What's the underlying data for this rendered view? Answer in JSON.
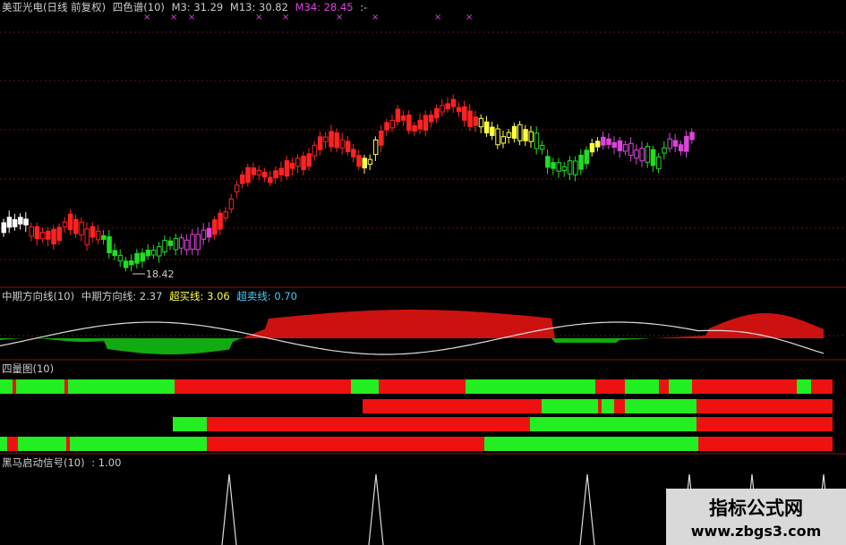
{
  "panel1": {
    "stock_name": "美亚光电(日线 前复权)",
    "indicator": "四色谱(10)",
    "m3": "M3: 31.29",
    "m13": "M13: 30.82",
    "m34": "M34: 28.45",
    "tail": ":-",
    "low_label": "18.42"
  },
  "panel2": {
    "name": "中期方向线(10)",
    "direction": "中期方向线: 2.37",
    "overbought": "超买线: 3.06",
    "oversold": "超卖线: 0.70"
  },
  "panel3": {
    "name": "四量图(10)"
  },
  "panel4": {
    "name": "黑马启动信号(10)",
    "value": ": 1.00"
  },
  "watermark": {
    "title": "指标公式网",
    "url": "www.zbgs3.com"
  },
  "colors": {
    "up": "#ff2222",
    "down": "#22dd22",
    "yellow": "#ffff44",
    "magenta": "#dd44dd",
    "white": "#ffffff",
    "grid": "#7a1010"
  },
  "four_volume_bars": [
    [
      "g",
      "r",
      "g",
      "r",
      "g",
      "r",
      "g",
      "r",
      "g",
      "r",
      "g",
      "r",
      "g",
      "r"
    ],
    [
      "r",
      "g",
      "r",
      "g",
      "r"
    ],
    [
      "g",
      "r",
      "g",
      "r"
    ],
    [
      "g",
      "r",
      "g",
      "r",
      "g",
      "r"
    ]
  ],
  "signal_times": [
    1,
    2,
    3,
    4,
    5,
    6
  ]
}
